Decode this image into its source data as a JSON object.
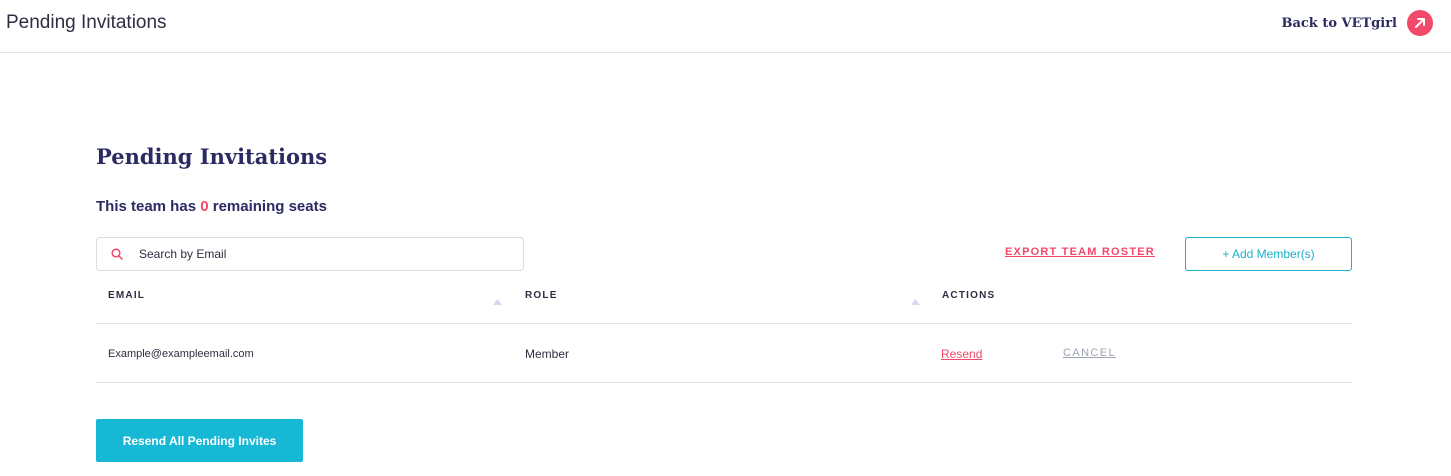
{
  "header": {
    "title": "Pending Invitations",
    "back_link_label": "Back to VETgirl",
    "back_icon": "arrow-up-right-icon"
  },
  "main": {
    "title": "Pending Invitations",
    "seats": {
      "prefix": "This team has",
      "count": "0",
      "suffix": "remaining seats"
    },
    "search": {
      "placeholder": "Search by Email",
      "value": "",
      "icon": "search-icon"
    },
    "export_label": "EXPORT TEAM ROSTER",
    "add_member_label": "+ Add Member(s)",
    "table": {
      "columns": [
        "EMAIL",
        "ROLE",
        "ACTIONS"
      ],
      "rows": [
        {
          "email": "Example@exampleemail.com",
          "role": "Member",
          "resend_label": "Resend",
          "cancel_label": "CANCEL"
        }
      ]
    },
    "resend_all_label": "Resend All Pending Invites"
  },
  "colors": {
    "accent": "#f2486a",
    "primary_text": "#2b2a63",
    "teal": "#17b8d6"
  }
}
